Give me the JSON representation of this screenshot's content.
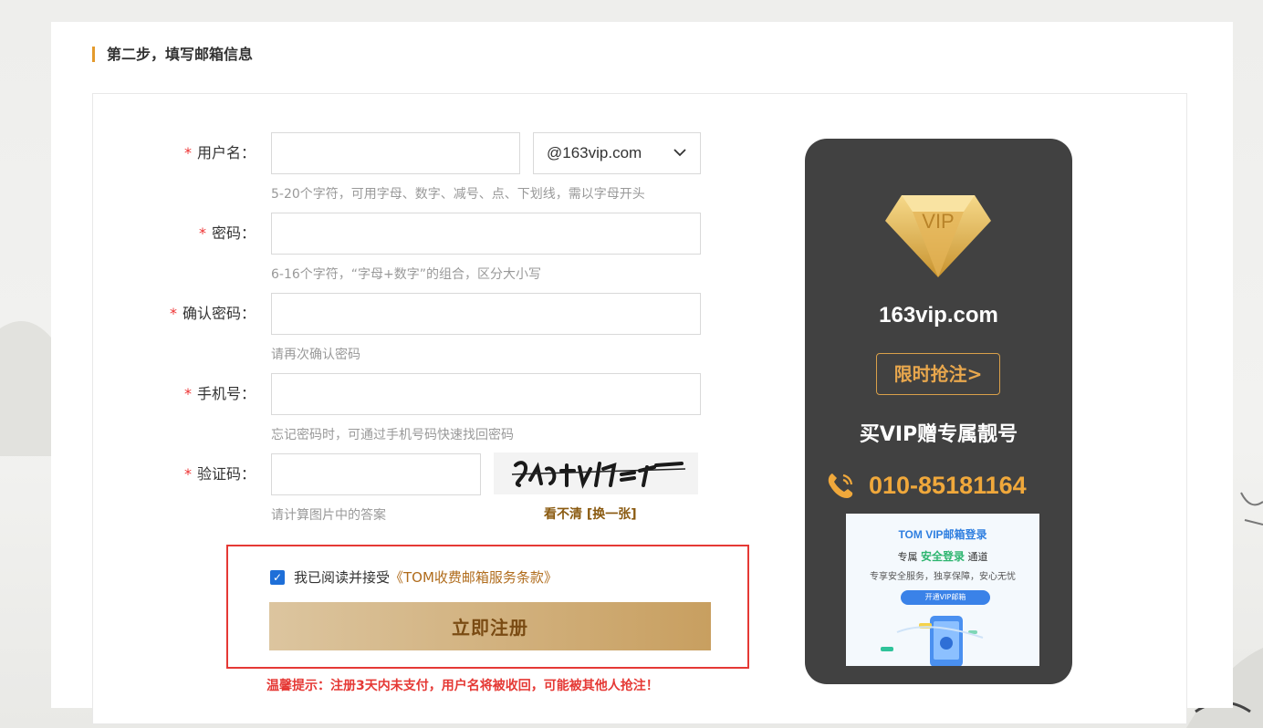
{
  "step": {
    "title": "第二步，填写邮箱信息"
  },
  "form": {
    "username": {
      "label": "用户名：",
      "required_mark": "*",
      "value": "",
      "hint": "5-20个字符，可用字母、数字、减号、点、下划线，需以字母开头"
    },
    "domain_select": {
      "value": "@163vip.com"
    },
    "password": {
      "label": "密码：",
      "required_mark": "*",
      "value": "",
      "hint": "6-16个字符，“字母+数字”的组合，区分大小写"
    },
    "confirm_password": {
      "label": "确认密码：",
      "required_mark": "*",
      "value": "",
      "hint": "请再次确认密码"
    },
    "phone": {
      "label": "手机号：",
      "required_mark": "*",
      "value": "",
      "hint": "忘记密码时，可通过手机号码快速找回密码"
    },
    "captcha": {
      "label": "验证码：",
      "required_mark": "*",
      "value": "",
      "hint": "请计算图片中的答案",
      "unclear_text": "看不清",
      "refresh_text": "[换一张]"
    },
    "agreement": {
      "checked": true,
      "text": "我已阅读并接受",
      "terms_link": "《TOM收费邮箱服务条款》"
    },
    "submit_label": "立即注册",
    "warning": "温馨提示：注册3天内未支付，用户名将被收回，可能被其他人抢注！"
  },
  "vip_ad": {
    "badge_text": "VIP",
    "domain": "163vip.com",
    "cta": "限时抢注>",
    "slogan": "买VIP赠专属靓号",
    "phone": "010-85181164",
    "promo": {
      "title": "TOM VIP邮箱登录",
      "sub_prefix": "专属",
      "sub_highlight": "安全登录",
      "sub_suffix": "通道",
      "line": "专享安全服务，独享保障，安心无忧",
      "button": "开通VIP邮箱"
    }
  },
  "colors": {
    "accent": "#e49a2c",
    "submit_gradient_start": "#dcc59f",
    "submit_gradient_end": "#c89f60",
    "vip_card_bg": "#414141",
    "phone": "#f0a83b",
    "highlight_border": "#e53935",
    "required": "#e33333"
  }
}
